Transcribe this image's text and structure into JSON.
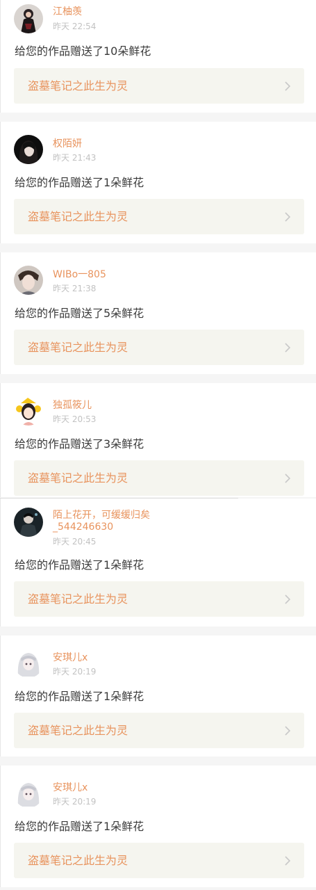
{
  "notifications": [
    {
      "username": "江柚羡",
      "time": "昨天 22:54",
      "message": "给您的作品赠送了10朵鲜花",
      "work_title": "盗墓笔记之此生为灵",
      "avatar": "avatar-dark-outfit"
    },
    {
      "username": "权陌妍",
      "time": "昨天 21:43",
      "message": "给您的作品赠送了1朵鲜花",
      "work_title": "盗墓笔记之此生为灵",
      "avatar": "avatar-dark-hair-girl"
    },
    {
      "username": "WIBo一805",
      "time": "昨天 21:38",
      "message": "给您的作品赠送了5朵鲜花",
      "work_title": "盗墓笔记之此生为灵",
      "avatar": "avatar-boy-portrait"
    },
    {
      "username": "独孤筱儿",
      "time": "昨天 20:53",
      "message": "给您的作品赠送了3朵鲜花",
      "work_title": "盗墓笔记之此生为灵",
      "avatar": "avatar-yellow-cartoon"
    },
    {
      "username": "陌上花开，可缓缓归矣_544246630",
      "time": "昨天 20:45",
      "message": "给您的作品赠送了1朵鲜花",
      "work_title": "盗墓笔记之此生为灵",
      "avatar": "avatar-dark-figure"
    },
    {
      "username": "安琪儿x",
      "time": "昨天 20:19",
      "message": "给您的作品赠送了1朵鲜花",
      "work_title": "盗墓笔记之此生为灵",
      "avatar": "avatar-anime-girl"
    },
    {
      "username": "安琪儿x",
      "time": "昨天 20:19",
      "message": "给您的作品赠送了1朵鲜花",
      "work_title": "盗墓笔记之此生为灵",
      "avatar": "avatar-anime-girl"
    }
  ],
  "colors": {
    "accent": "#e8935d",
    "time": "#c2c2c2",
    "message": "#3a3a3a",
    "link_bg": "#f5f5ef",
    "separator": "#f5f5f5"
  },
  "icons": {
    "chevron": "chevron-right-icon"
  }
}
